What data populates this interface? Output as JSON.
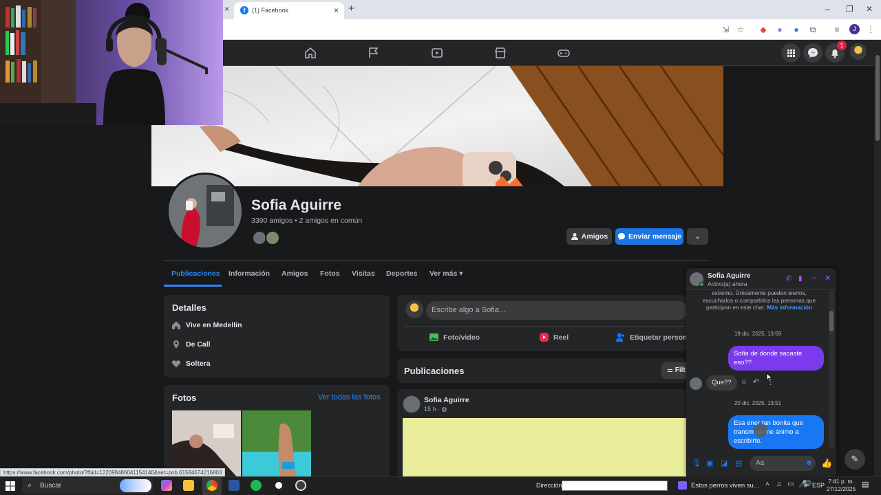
{
  "browser": {
    "tab_title": "(1) Facebook",
    "close_glyph": "×",
    "new_tab_glyph": "+",
    "window_controls": [
      "–",
      "❐",
      "✕"
    ]
  },
  "fb_nav": {
    "notif_count": "1"
  },
  "profile": {
    "name": "Sofia Aguirre",
    "friends_meta": "3390 amigos • 2 amigos en común",
    "btn_friends": "Amigos",
    "btn_message": "Enviar mensaje",
    "tabs": [
      "Publicaciones",
      "Información",
      "Amigos",
      "Fotos",
      "Visitas",
      "Deportes",
      "Ver más"
    ]
  },
  "details": {
    "title": "Detalles",
    "rows": [
      "Vive en Medellín",
      "De Call",
      "Soltera"
    ]
  },
  "photos": {
    "title": "Fotos",
    "see_all": "Ver todas las fotos"
  },
  "compose": {
    "placeholder": "Escribe algo a Sofia...",
    "actions": [
      "Foto/video",
      "Reel",
      "Etiquetar persona"
    ]
  },
  "posts": {
    "title": "Publicaciones",
    "filter_label": "Filt",
    "author": "Sofia Aguirre",
    "time": "15 h ·"
  },
  "chat": {
    "name": "Sofia Aguirre",
    "status": "Activo(a) ahora",
    "notice": "extremo. Únicamente pueden leerlos, escucharlos o compartirlos las personas que participan en este chat.",
    "notice_link": "Más información",
    "date1": "19 dic. 2025, 13:59",
    "msg1": "Sofia de donde sacaste eso??",
    "reply1": "Que??",
    "date2": "20 dic. 2025, 13:51",
    "msg2": "Esa ener tan bonita que transm ue me ánimo a escribirte.",
    "input_placeholder": "Aa"
  },
  "status_url": "https://www.facebook.com/photo/?fbid=122098486041154140&set=pob.61584674216803",
  "taskbar": {
    "search_label": "Buscar",
    "address_label": "Dirección",
    "media_title": "Estos perros viven su...",
    "lang": "ESP",
    "time": "7:41 p. m.",
    "date": "27/12/2025"
  },
  "colors": {
    "fb_bg": "#18191a",
    "card": "#242526",
    "accent_blue": "#1b74e4",
    "chat_purple": "#7c3aed",
    "link_blue": "#2d88ff"
  }
}
